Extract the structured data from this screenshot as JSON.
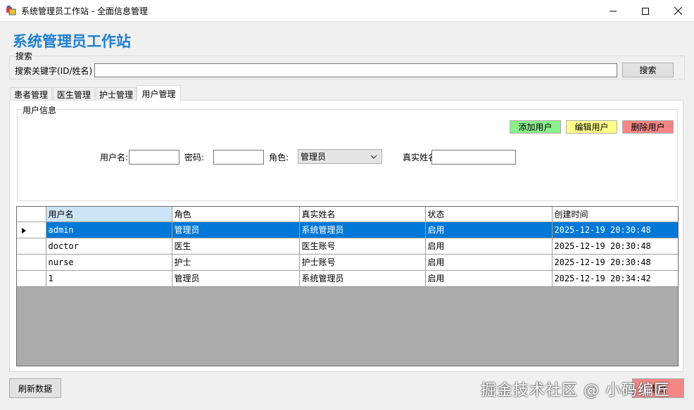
{
  "window": {
    "title": "系统管理员工作站 - 全面信息管理"
  },
  "header": {
    "title": "系统管理员工作站"
  },
  "search": {
    "group_label": "搜索",
    "label": "搜索关键字(ID/姓名)",
    "value": "",
    "button": "搜索"
  },
  "tabs": [
    {
      "label": "患者管理",
      "active": false
    },
    {
      "label": "医生管理",
      "active": false
    },
    {
      "label": "护士管理",
      "active": false
    },
    {
      "label": "用户管理",
      "active": true
    }
  ],
  "user_info": {
    "group_label": "用户信息",
    "add_button": "添加用户",
    "edit_button": "编辑用户",
    "delete_button": "删除用户",
    "username_label": "用户名:",
    "username_value": "",
    "password_label": "密码:",
    "password_value": "",
    "role_label": "角色:",
    "role_value": "管理员",
    "realname_label": "真实姓名",
    "realname_value": ""
  },
  "grid": {
    "columns": [
      "用户名",
      "角色",
      "真实姓名",
      "状态",
      "创建时间"
    ],
    "rows": [
      {
        "username": "admin",
        "role": "管理员",
        "realname": "系统管理员",
        "status": "启用",
        "created": "2025-12-19 20:30:48",
        "selected": true
      },
      {
        "username": "doctor",
        "role": "医生",
        "realname": "医生账号",
        "status": "启用",
        "created": "2025-12-19 20:30:48",
        "selected": false
      },
      {
        "username": "nurse",
        "role": "护士",
        "realname": "护士账号",
        "status": "启用",
        "created": "2025-12-19 20:30:48",
        "selected": false
      },
      {
        "username": "1",
        "role": "管理员",
        "realname": "系统管理员",
        "status": "启用",
        "created": "2025-12-19 20:34:42",
        "selected": false
      }
    ]
  },
  "footer": {
    "refresh_button": "刷新数据",
    "exit_button": "退出",
    "watermark": "掘金技术社区 @ 小码编匠"
  },
  "colors": {
    "accent": "#1d7fd1",
    "selection": "#0078d7",
    "add": "#8cf08c",
    "edit": "#ffff88",
    "delete": "#f48686"
  },
  "icons": {
    "app": "app-window-icon",
    "minimize": "minimize-icon",
    "maximize": "maximize-icon",
    "close": "close-icon",
    "dropdown": "chevron-down-icon",
    "row_pointer": "row-pointer-icon"
  }
}
